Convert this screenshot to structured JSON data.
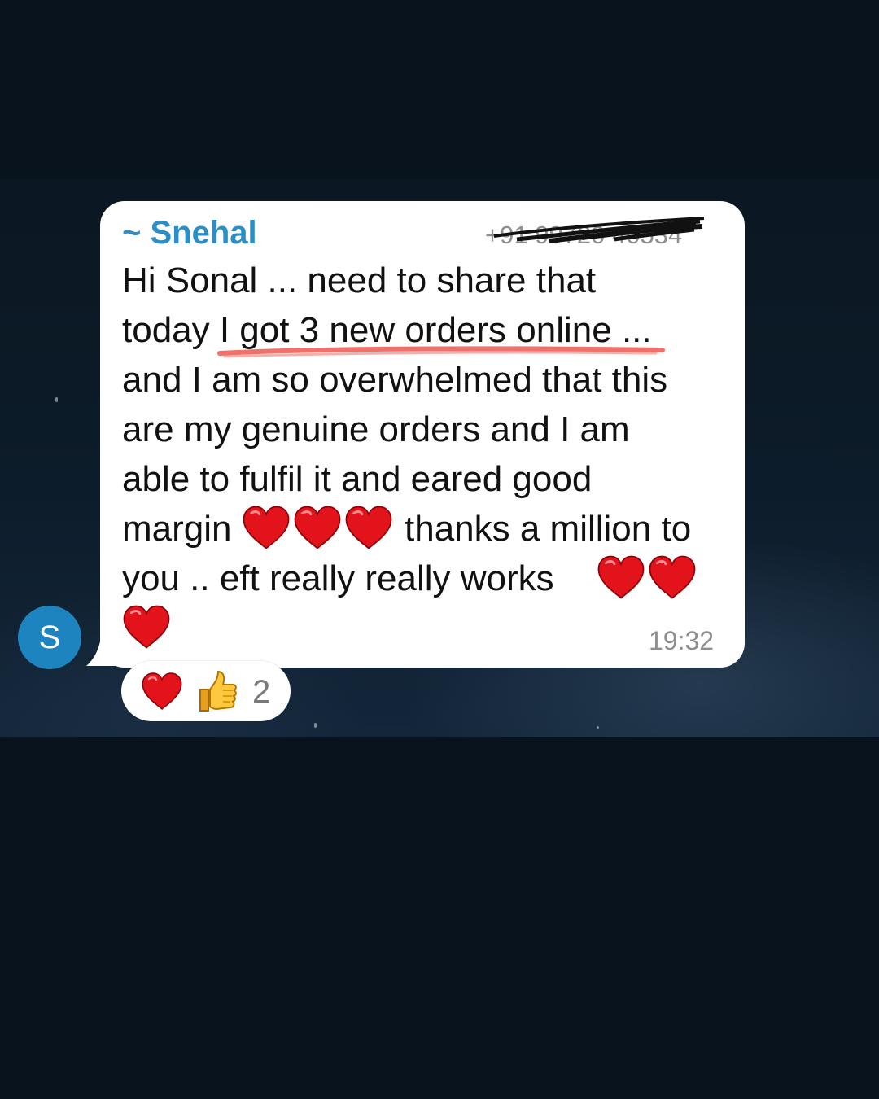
{
  "chat": {
    "avatar_letter": "S",
    "sender_name": "~ Snehal",
    "sender_phone": "+91 99720 40534",
    "message_lines": [
      "Hi Sonal ... need to share that",
      "today I got 3 new orders online ...",
      "and I am so overwhelmed that this",
      "are my genuine orders and I am",
      "able to fulfil it and eared good",
      "margin",
      "thanks a million to",
      "you .. eft really really works"
    ],
    "timestamp": "19:32",
    "reactions": {
      "icons": [
        "heart-emoji",
        "thumbs-up-emoji"
      ],
      "count": "2"
    }
  },
  "colors": {
    "background": "#08131d",
    "bubble": "#ffffff",
    "sender": "#2b8ec6",
    "avatar": "#1d84c0",
    "highlight_underline": "#f2706a",
    "heart": "#e3131b"
  }
}
